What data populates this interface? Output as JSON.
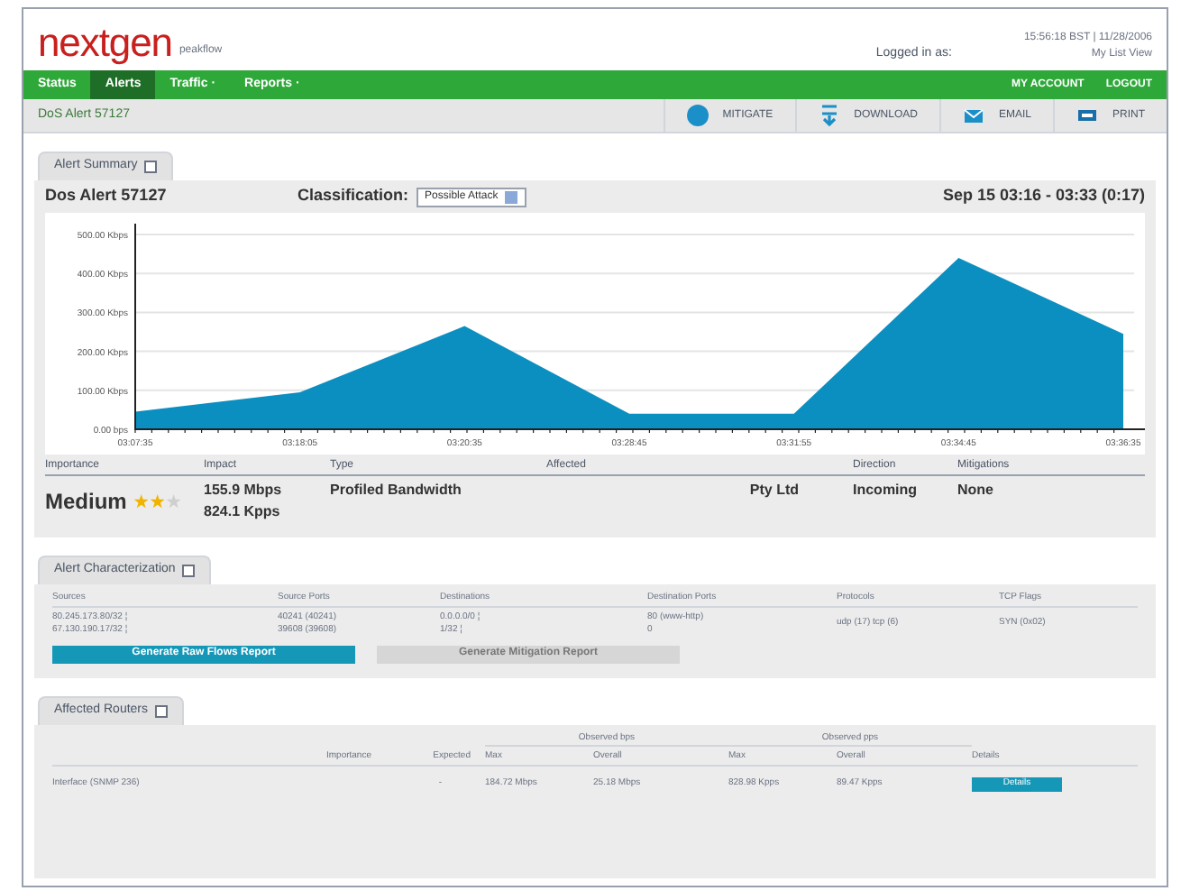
{
  "header": {
    "logo": "nextgen",
    "logo_subtitle": "peakflow",
    "logged_in": "Logged in as:",
    "timestamp": "15:56:18 BST | 11/28/2006",
    "view_link": "My List View"
  },
  "nav": {
    "items": [
      {
        "label": "Status",
        "selected": false
      },
      {
        "label": "Alerts",
        "selected": true
      },
      {
        "label": "Traffic ·",
        "selected": false
      },
      {
        "label": "Reports ·",
        "selected": false
      }
    ],
    "right": [
      "MY ACCOUNT",
      "LOGOUT"
    ]
  },
  "toolbar": {
    "title": "DoS Alert 57127",
    "buttons": [
      {
        "kind": "mitigate",
        "label": "MITIGATE"
      },
      {
        "kind": "download",
        "label": "DOWNLOAD"
      },
      {
        "kind": "email",
        "label": "EMAIL"
      },
      {
        "kind": "print",
        "label": "PRINT"
      }
    ]
  },
  "summary": {
    "tab": "Alert Summary",
    "title": "Dos Alert 57127",
    "classification_label": "Classification:",
    "classification": "Possible Attack",
    "time_range": "Sep 15 03:16 - 03:33 (0:17)",
    "chart_data": {
      "type": "area",
      "categories": [
        "03:07:35",
        "03:18:05",
        "03:20:35",
        "03:28:45",
        "03:31:55",
        "03:34:45",
        "03:36:35"
      ],
      "grid": true,
      "series": [
        {
          "color": "#0a8fc0",
          "values": [
            45,
            95,
            265,
            40,
            40,
            440,
            245
          ]
        }
      ],
      "ylim": [
        0,
        500
      ],
      "yticks": [
        {
          "value": 0,
          "label": "0.00 bps"
        },
        {
          "value": 100,
          "label": "100.00 Kbps"
        },
        {
          "value": 200,
          "label": "200.00 Kbps"
        },
        {
          "value": 300,
          "label": "300.00 Kbps"
        },
        {
          "value": 400,
          "label": "400.00 Kbps"
        },
        {
          "value": 500,
          "label": "500.00 Kbps"
        }
      ]
    },
    "columns": [
      "Importance",
      "Impact",
      "Type",
      "Affected",
      "Direction",
      "Mitigations"
    ],
    "importance": "Medium",
    "stars": 2,
    "impact": [
      "155.9 Mbps",
      "824.1 Kpps"
    ],
    "type": "Profiled Bandwidth",
    "affected": "Pty Ltd",
    "direction": "Incoming",
    "mitigations": "None"
  },
  "characterization": {
    "tab": "Alert Characterization",
    "columns": [
      "Sources",
      "Source Ports",
      "Destinations",
      "Destination Ports",
      "Protocols",
      "TCP Flags"
    ],
    "cells": [
      [
        "80.245.173.80/32 ¦",
        "67.130.190.17/32 ¦"
      ],
      [
        "40241 (40241)",
        "39608 (39608)"
      ],
      [
        "0.0.0.0/0 ¦",
        "1/32 ¦"
      ],
      [
        "80 (www-http)",
        "0"
      ],
      [
        "udp (17) tcp (6)"
      ],
      [
        "SYN (0x02)"
      ]
    ],
    "buttons": [
      {
        "label": "Generate Raw Flows Report",
        "disabled": false
      },
      {
        "label": "Generate Mitigation Report",
        "disabled": true
      }
    ]
  },
  "routers": {
    "tab": "Affected Routers",
    "group_headers": [
      "Observed bps",
      "Observed pps"
    ],
    "columns": [
      "",
      "Importance",
      "Expected",
      "Max",
      "Overall",
      "Max",
      "Overall",
      "Details"
    ],
    "rows": [
      {
        "cells": [
          "Interface (SNMP 236)",
          "",
          "-",
          "184.72 Mbps",
          "25.18 Mbps",
          "828.98 Kpps",
          "89.47 Kpps"
        ],
        "details": "Details"
      }
    ]
  }
}
